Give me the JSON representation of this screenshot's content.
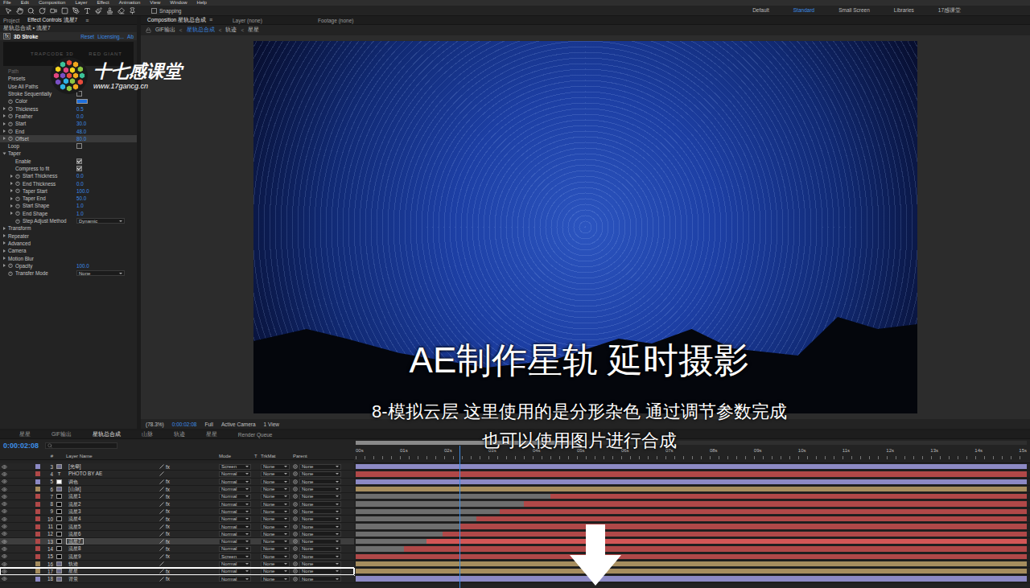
{
  "menu": [
    "File",
    "Edit",
    "Composition",
    "Layer",
    "Effect",
    "Animation",
    "View",
    "Window",
    "Help"
  ],
  "menu_icon": "≡",
  "toolbar": {
    "snapping": {
      "label": "Snapping",
      "checked": false
    },
    "workspaces": [
      {
        "label": "Default",
        "selected": false
      },
      {
        "label": "Standard",
        "selected": true
      },
      {
        "label": "Small Screen",
        "selected": false
      },
      {
        "label": "Libraries",
        "selected": false
      },
      {
        "label": "17感课堂",
        "selected": false
      }
    ]
  },
  "left_panel": {
    "tabs": [
      {
        "label": "Project",
        "selected": false
      },
      {
        "label": "Effect Controls 流星7",
        "selected": true
      }
    ],
    "breadcrumb": "星轨总合成 • 流星7",
    "effect": {
      "fx": "fx",
      "name": "3D Stroke",
      "links": [
        "Reset",
        "Licensing...",
        "Ab"
      ]
    },
    "brand": {
      "product": "TRAPCODE 3D",
      "maker": "RED GIANT"
    },
    "params": [
      {
        "label": "Path",
        "kind": "label",
        "disabled": true,
        "selected": false
      },
      {
        "label": "Presets",
        "kind": "label",
        "disabled": false,
        "selected": false
      },
      {
        "label": "Use All Paths",
        "kind": "label",
        "disabled": false,
        "selected": false
      },
      {
        "label": "Stroke Sequentially",
        "kind": "checkbox",
        "checked": false,
        "selected": false
      },
      {
        "label": "Color",
        "kind": "color",
        "color": "#1f6fdc",
        "selected": false
      },
      {
        "label": "Thickness",
        "kind": "value",
        "value": "0.5",
        "selected": false
      },
      {
        "label": "Feather",
        "kind": "value",
        "value": "0.0",
        "selected": false
      },
      {
        "label": "Start",
        "kind": "value",
        "value": "30.0",
        "selected": false
      },
      {
        "label": "End",
        "kind": "value",
        "value": "48.0",
        "selected": false
      },
      {
        "label": "Offset",
        "kind": "value",
        "value": "80.0",
        "selected": true
      },
      {
        "label": "Loop",
        "kind": "checkbox",
        "checked": false,
        "selected": false
      },
      {
        "label": "Taper",
        "kind": "group",
        "expanded": true,
        "selected": false,
        "children": [
          {
            "label": "Enable",
            "kind": "checkbox",
            "checked": true,
            "selected": false
          },
          {
            "label": "Compress to fit",
            "kind": "checkbox",
            "checked": true,
            "selected": false
          },
          {
            "label": "Start Thickness",
            "kind": "value",
            "value": "0.0",
            "selected": false
          },
          {
            "label": "End Thickness",
            "kind": "value",
            "value": "0.0",
            "selected": false
          },
          {
            "label": "Taper Start",
            "kind": "value",
            "value": "100.0",
            "selected": false
          },
          {
            "label": "Taper End",
            "kind": "value",
            "value": "50.0",
            "selected": false
          },
          {
            "label": "Start Shape",
            "kind": "value",
            "value": "1.0",
            "selected": false
          },
          {
            "label": "End Shape",
            "kind": "value",
            "value": "1.0",
            "selected": false
          },
          {
            "label": "Step Adjust Method",
            "kind": "select",
            "value": "Dynamic",
            "selected": false
          }
        ]
      },
      {
        "label": "Transform",
        "kind": "group",
        "expanded": false,
        "selected": false,
        "children": []
      },
      {
        "label": "Repeater",
        "kind": "group",
        "expanded": false,
        "selected": false,
        "children": []
      },
      {
        "label": "Advanced",
        "kind": "group",
        "expanded": false,
        "selected": false,
        "children": []
      },
      {
        "label": "Camera",
        "kind": "group",
        "expanded": false,
        "selected": false,
        "children": []
      },
      {
        "label": "Motion Blur",
        "kind": "group",
        "expanded": false,
        "selected": false,
        "children": []
      },
      {
        "label": "Opacity",
        "kind": "value",
        "value": "100.0",
        "selected": false
      },
      {
        "label": "Transfer Mode",
        "kind": "select",
        "value": "None",
        "selected": false
      }
    ]
  },
  "watermark": {
    "name": "十七感课堂",
    "url": "www.17gancg.cn"
  },
  "viewer": {
    "tabs": [
      {
        "label": "Composition 星轨总合成",
        "selected": true
      },
      {
        "label": "Layer (none)",
        "selected": false
      },
      {
        "label": "Footage (none)",
        "selected": false
      }
    ],
    "separator": "<",
    "breadcrumbs": [
      {
        "label": "GIF输出",
        "selected": false
      },
      {
        "label": "星轨总合成",
        "selected": true
      },
      {
        "label": "轨迹",
        "selected": false
      },
      {
        "label": "星星",
        "selected": false
      }
    ],
    "footer": {
      "zoom": "(78.3%)",
      "timecode": "0:00:02:08",
      "resolution": "Full",
      "camera": "Active Camera",
      "views": "1 View"
    }
  },
  "captions": {
    "title": "AE制作星轨 延时摄影",
    "lines": [
      "8-模拟云层 这里使用的是分形杂色 通过调节参数完成",
      "也可以使用图片进行合成"
    ]
  },
  "timeline": {
    "tabs": [
      {
        "label": "星星",
        "selected": false
      },
      {
        "label": "GIF输出",
        "selected": false
      },
      {
        "label": "星轨总合成",
        "selected": true
      },
      {
        "label": "山脉",
        "selected": false
      },
      {
        "label": "轨迹",
        "selected": false
      },
      {
        "label": "星星",
        "selected": false
      },
      {
        "label": "Render Queue",
        "selected": false
      }
    ],
    "timecode": "0:00:02:08",
    "columns": [
      "#",
      "Layer Name",
      "Mode",
      "T",
      "TrkMat",
      "Parent"
    ],
    "fx": "fx",
    "ruler": [
      "00s",
      "01s",
      "02s",
      "03s",
      "04s",
      "05s",
      "06s",
      "07s",
      "08s",
      "09s",
      "10s",
      "11s",
      "12s",
      "13s",
      "14s",
      "15s"
    ],
    "playhead": 0.155,
    "work_area": 0.33,
    "layers": [
      {
        "num": "3",
        "name": "[光晕]",
        "kind": "precomp",
        "mode": "Screen",
        "trkmat": "None",
        "parent": "None",
        "color": "#8c89c4",
        "start": 0,
        "fx": true,
        "selected": false,
        "highlighted": false
      },
      {
        "num": "4",
        "name": "PHOTO BY AE",
        "kind": "text",
        "icon": "T",
        "mode": "Normal",
        "trkmat": "None",
        "parent": "None",
        "color": "#b04848",
        "start": 0,
        "fx": false,
        "selected": false,
        "highlighted": false
      },
      {
        "num": "5",
        "name": "调色",
        "kind": "adjustment",
        "mode": "Normal",
        "trkmat": "None",
        "parent": "None",
        "color": "#8c89c4",
        "start": 0,
        "fx": true,
        "selected": false,
        "highlighted": false
      },
      {
        "num": "6",
        "name": "[山脉]",
        "kind": "precomp",
        "mode": "Normal",
        "trkmat": "None",
        "parent": "None",
        "color": "#a68d5e",
        "start": 0,
        "fx": true,
        "selected": false,
        "highlighted": false
      },
      {
        "num": "7",
        "name": "流星1",
        "kind": "solid",
        "mode": "Normal",
        "trkmat": "None",
        "parent": "None",
        "color": "#b04848",
        "start": 0.29,
        "fx": true,
        "selected": false,
        "highlighted": false
      },
      {
        "num": "8",
        "name": "流星2",
        "kind": "solid",
        "mode": "Normal",
        "trkmat": "None",
        "parent": "None",
        "color": "#b04848",
        "start": 0.25,
        "fx": true,
        "selected": false,
        "highlighted": false
      },
      {
        "num": "9",
        "name": "流星3",
        "kind": "solid",
        "mode": "Normal",
        "trkmat": "None",
        "parent": "None",
        "color": "#b04848",
        "start": 0.215,
        "fx": true,
        "selected": false,
        "highlighted": false
      },
      {
        "num": "10",
        "name": "流星4",
        "kind": "solid",
        "mode": "Normal",
        "trkmat": "None",
        "parent": "None",
        "color": "#b04848",
        "start": 0.18,
        "fx": true,
        "selected": false,
        "highlighted": false
      },
      {
        "num": "11",
        "name": "流星5",
        "kind": "solid",
        "mode": "Normal",
        "trkmat": "None",
        "parent": "None",
        "color": "#b04848",
        "start": 0.155,
        "fx": true,
        "selected": false,
        "highlighted": false
      },
      {
        "num": "12",
        "name": "流星6",
        "kind": "solid",
        "mode": "Normal",
        "trkmat": "None",
        "parent": "None",
        "color": "#b04848",
        "start": 0.13,
        "fx": true,
        "selected": false,
        "highlighted": false
      },
      {
        "num": "13",
        "name": "流星7",
        "kind": "solid",
        "mode": "Normal",
        "trkmat": "None",
        "parent": "None",
        "color": "#b04848",
        "start": 0.105,
        "fx": true,
        "selected": true,
        "highlighted": false
      },
      {
        "num": "14",
        "name": "流星8",
        "kind": "solid",
        "mode": "Normal",
        "trkmat": "None",
        "parent": "None",
        "color": "#b04848",
        "start": 0.072,
        "fx": true,
        "selected": false,
        "highlighted": false
      },
      {
        "num": "15",
        "name": "流星9",
        "kind": "solid",
        "mode": "Screen",
        "trkmat": "None",
        "parent": "None",
        "color": "#b04848",
        "start": 0,
        "fx": true,
        "selected": false,
        "highlighted": false
      },
      {
        "num": "16",
        "name": "轨迹",
        "kind": "precomp",
        "mode": "Normal",
        "trkmat": "None",
        "parent": "None",
        "color": "#a68d5e",
        "start": 0,
        "fx": false,
        "selected": false,
        "highlighted": false
      },
      {
        "num": "17",
        "name": "星星",
        "kind": "precomp",
        "mode": "Normal",
        "trkmat": "None",
        "parent": "None",
        "color": "#a68d5e",
        "start": 0,
        "fx": true,
        "selected": false,
        "highlighted": true
      },
      {
        "num": "18",
        "name": "背景",
        "kind": "precomp",
        "mode": "Normal",
        "trkmat": "None",
        "parent": "None",
        "color": "#8c89c4",
        "start": 0,
        "fx": true,
        "selected": false,
        "highlighted": false
      }
    ]
  }
}
